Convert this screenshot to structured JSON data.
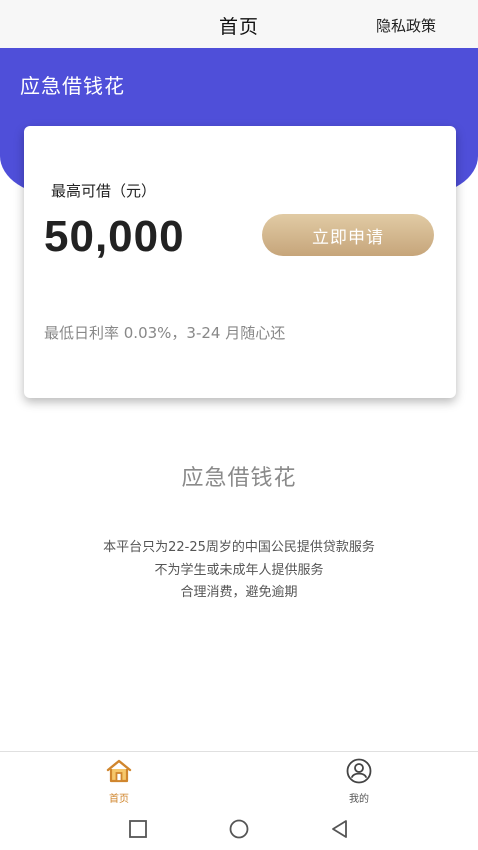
{
  "header": {
    "title": "首页",
    "privacy_link": "隐私政策"
  },
  "banner": {
    "app_name": "应急借钱花"
  },
  "loan_card": {
    "max_label": "最高可借（元）",
    "amount": "50,000",
    "apply_button": "立即申请",
    "rate_text": "最低日利率 0.03%，3-24 月随心还"
  },
  "section": {
    "title": "应急借钱花",
    "notices": [
      "本平台只为22-25周岁的中国公民提供贷款服务",
      "不为学生或未成年人提供服务",
      "合理消费，避免逾期"
    ]
  },
  "tabbar": {
    "tabs": [
      {
        "label": "首页",
        "icon": "home-icon",
        "active": true
      },
      {
        "label": "我的",
        "icon": "user-icon",
        "active": false
      }
    ]
  },
  "colors": {
    "brand": "#4f4fd9",
    "accent": "#d0862e",
    "button_gold": "#c6a57a"
  }
}
